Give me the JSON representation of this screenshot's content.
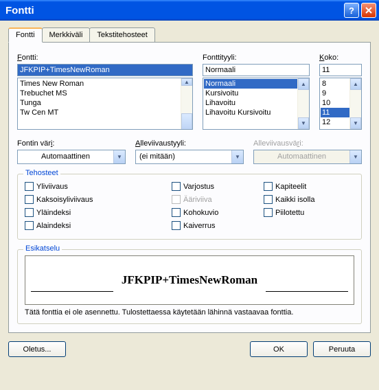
{
  "title": "Fontti",
  "tabs": [
    "Fontti",
    "Merkkiväli",
    "Tekstitehosteet"
  ],
  "labels": {
    "font": "Fontti:",
    "style": "Fonttityyli:",
    "size": "Koko:",
    "color": "Fontin väri:",
    "uline_style": "Alleviivaustyyli:",
    "uline_color": "Alleviivausväri:"
  },
  "font_value": "JFKPIP+TimesNewRoman",
  "style_value": "Normaali",
  "size_value": "11",
  "font_list": [
    "Times New Roman",
    "Trebuchet MS",
    "Tunga",
    "Tw Cen MT"
  ],
  "style_list": [
    "Normaali",
    "Kursivoitu",
    "Lihavoitu",
    "Lihavoitu Kursivoitu"
  ],
  "size_list": [
    "8",
    "9",
    "10",
    "11",
    "12"
  ],
  "style_selected": "Normaali",
  "size_selected": "11",
  "color_combo": "Automaattinen",
  "uline_style_combo": "(ei mitään)",
  "uline_color_combo": "Automaattinen",
  "effects_title": "Tehosteet",
  "effects": {
    "col1": [
      "Yliviivaus",
      "Kaksoisyliviivaus",
      "Yläindeksi",
      "Alaindeksi"
    ],
    "col2": [
      "Varjostus",
      "Ääriviiva",
      "Kohokuvio",
      "Kaiverrus"
    ],
    "col3": [
      "Kapiteelit",
      "Kaikki isolla",
      "Piilotettu"
    ]
  },
  "preview_title": "Esikatselu",
  "preview_text": "JFKPIP+TimesNewRoman",
  "note": "Tätä fonttia ei ole asennettu. Tulostettaessa käytetään lähinnä vastaavaa fonttia.",
  "buttons": {
    "default": "Oletus...",
    "ok": "OK",
    "cancel": "Peruuta"
  }
}
